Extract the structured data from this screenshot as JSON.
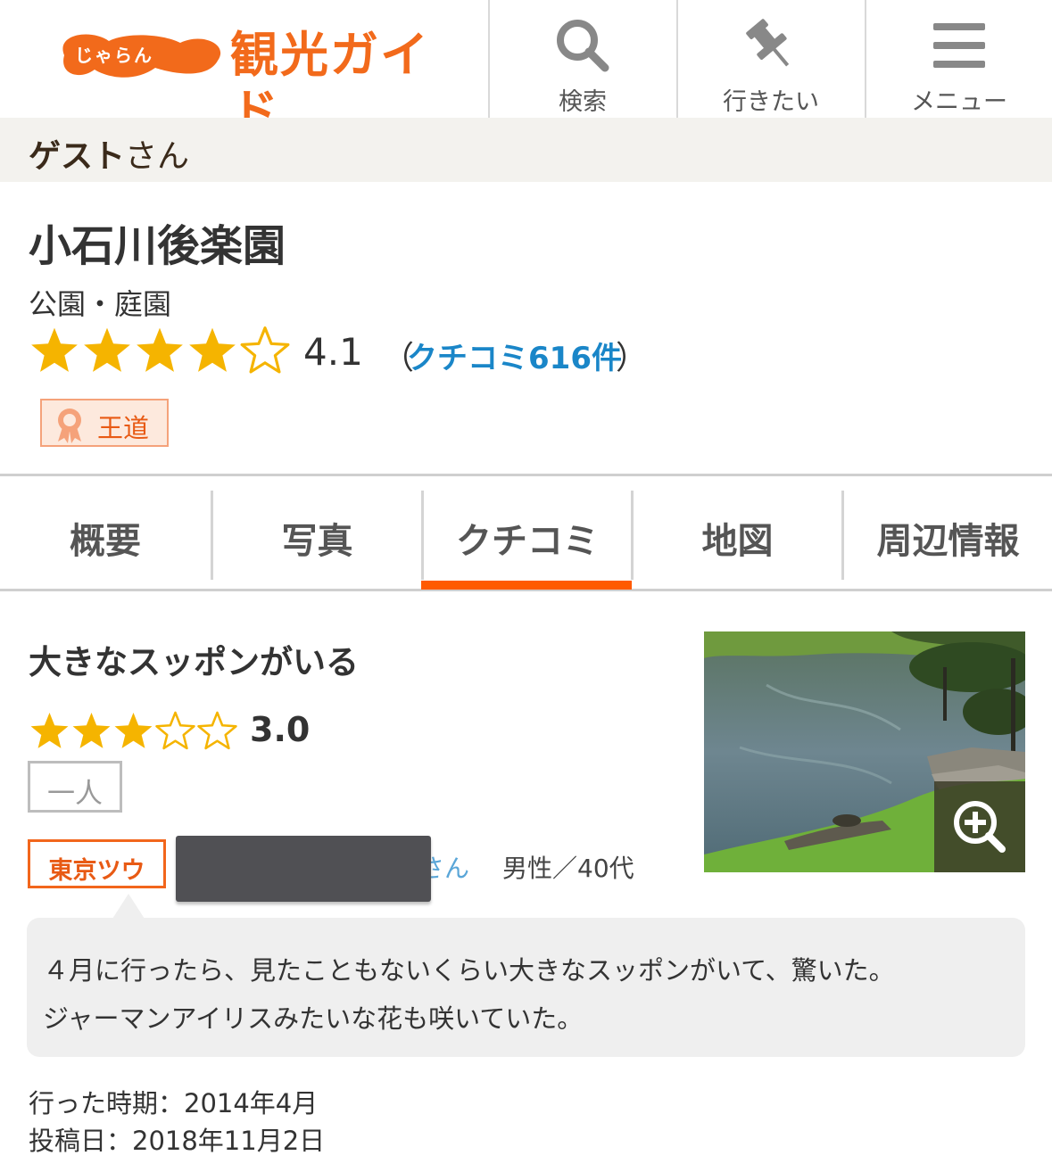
{
  "header": {
    "logo_small": "じゃらん",
    "logo_text": "観光ガイド",
    "buttons": [
      {
        "label": "検索",
        "icon": "search-icon"
      },
      {
        "label": "行きたい",
        "icon": "pushpin-icon"
      },
      {
        "label": "メニュー",
        "icon": "menu-icon"
      }
    ]
  },
  "guest": {
    "name": "ゲスト",
    "suffix": "さん"
  },
  "spot": {
    "title": "小石川後楽園",
    "category": "公園・庭園",
    "rating": 4.1,
    "rating_text": "4.1",
    "paren_open": "（",
    "paren_close": "）",
    "review_link": "クチコミ616件",
    "badge": "王道"
  },
  "tabs": [
    {
      "label": "概要",
      "active": false
    },
    {
      "label": "写真",
      "active": false
    },
    {
      "label": "クチコミ",
      "active": true
    },
    {
      "label": "地図",
      "active": false
    },
    {
      "label": "周辺情報",
      "active": false
    }
  ],
  "review": {
    "title": "大きなスッポンがいる",
    "rating": 3.0,
    "rating_text": "3.0",
    "companion_tag": "一人",
    "region_tag": "東京ツウ",
    "user_suffix": "さん",
    "user_meta": "男性／40代",
    "body": "４月に行ったら、見たこともないくらい大きなスッポンがいて、驚いた。\nジャーマンアイリスみたいな花も咲いていた。",
    "visit": "行った時期：2014年4月",
    "posted": "投稿日：2018年11月2日"
  },
  "colors": {
    "brand_orange": "#f26a1b",
    "star_gold": "#f5b400",
    "link_blue": "#1a86c8",
    "tab_underline": "#ff5a00"
  }
}
